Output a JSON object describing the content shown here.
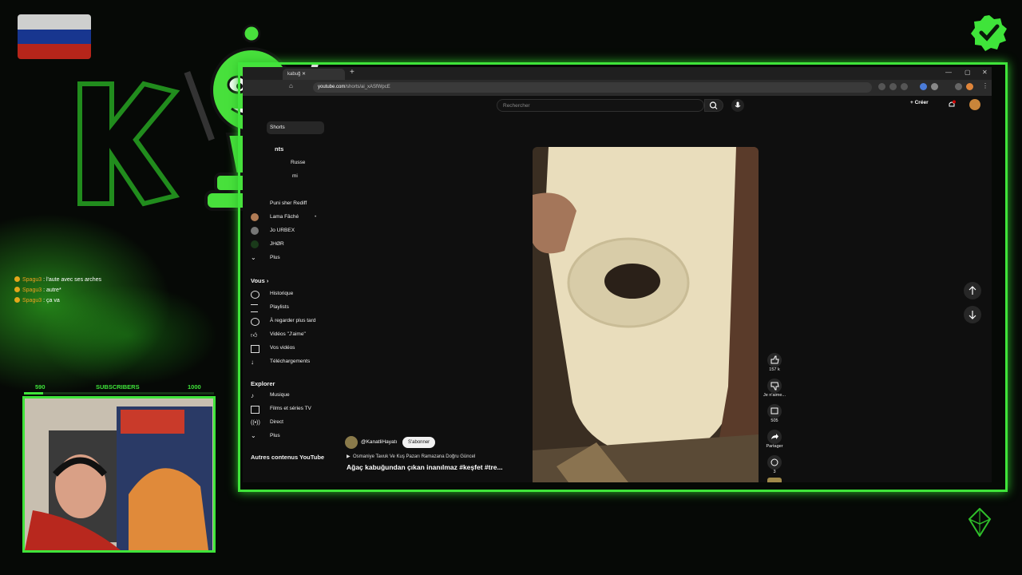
{
  "browser": {
    "tab_title": "kabuğ",
    "url_host": "youtube.com",
    "url_path": "/shorts/ai_xASfWpcE"
  },
  "youtube": {
    "search_placeholder": "Rechercher",
    "create_label": "Créer",
    "sidebar": {
      "shorts_label": "Shorts",
      "subscriptions_heading": "nts",
      "subscriptions": [
        "Russe",
        "mi",
        "Puni sher Rediff",
        "Lama Fâché",
        "Jo URBEX",
        "JHØR"
      ],
      "more_label": "Plus",
      "you_heading": "Vous",
      "you_items": [
        "Historique",
        "Playlists",
        "À regarder plus tard",
        "Vidéos \"J'aime\"",
        "Vos vidéos",
        "Téléchargements"
      ],
      "explore_heading": "Explorer",
      "explore_items": [
        "Musique",
        "Films et séries TV",
        "Direct",
        "Plus"
      ],
      "other_heading": "Autres contenus YouTube"
    },
    "short": {
      "channel": "@KanatliHayatı",
      "subscribe_label": "S'abonner",
      "music": "Osmaniye Tavuk Ve Kuş Pazarı Ramazana Doğru Güncel",
      "title": "Ağaç kabuğundan çıkan inanılmaz  #keşfet #tre...",
      "likes": "157 k",
      "dislike_label": "Je n'aime...",
      "comments": "505",
      "share_label": "Partager",
      "remix_count": "3"
    }
  },
  "overlay": {
    "chat": [
      {
        "user": "Spagu3",
        "message": "l'aute avec ses arches"
      },
      {
        "user": "Spagu3",
        "message": "autre*"
      },
      {
        "user": "Spagu3",
        "message": "ça va"
      }
    ],
    "subs_current": "590",
    "subs_label": "SUBSCRIBERS",
    "subs_goal": "1000",
    "subs_progress": 0.1,
    "accent_color": "#3fe43a"
  }
}
